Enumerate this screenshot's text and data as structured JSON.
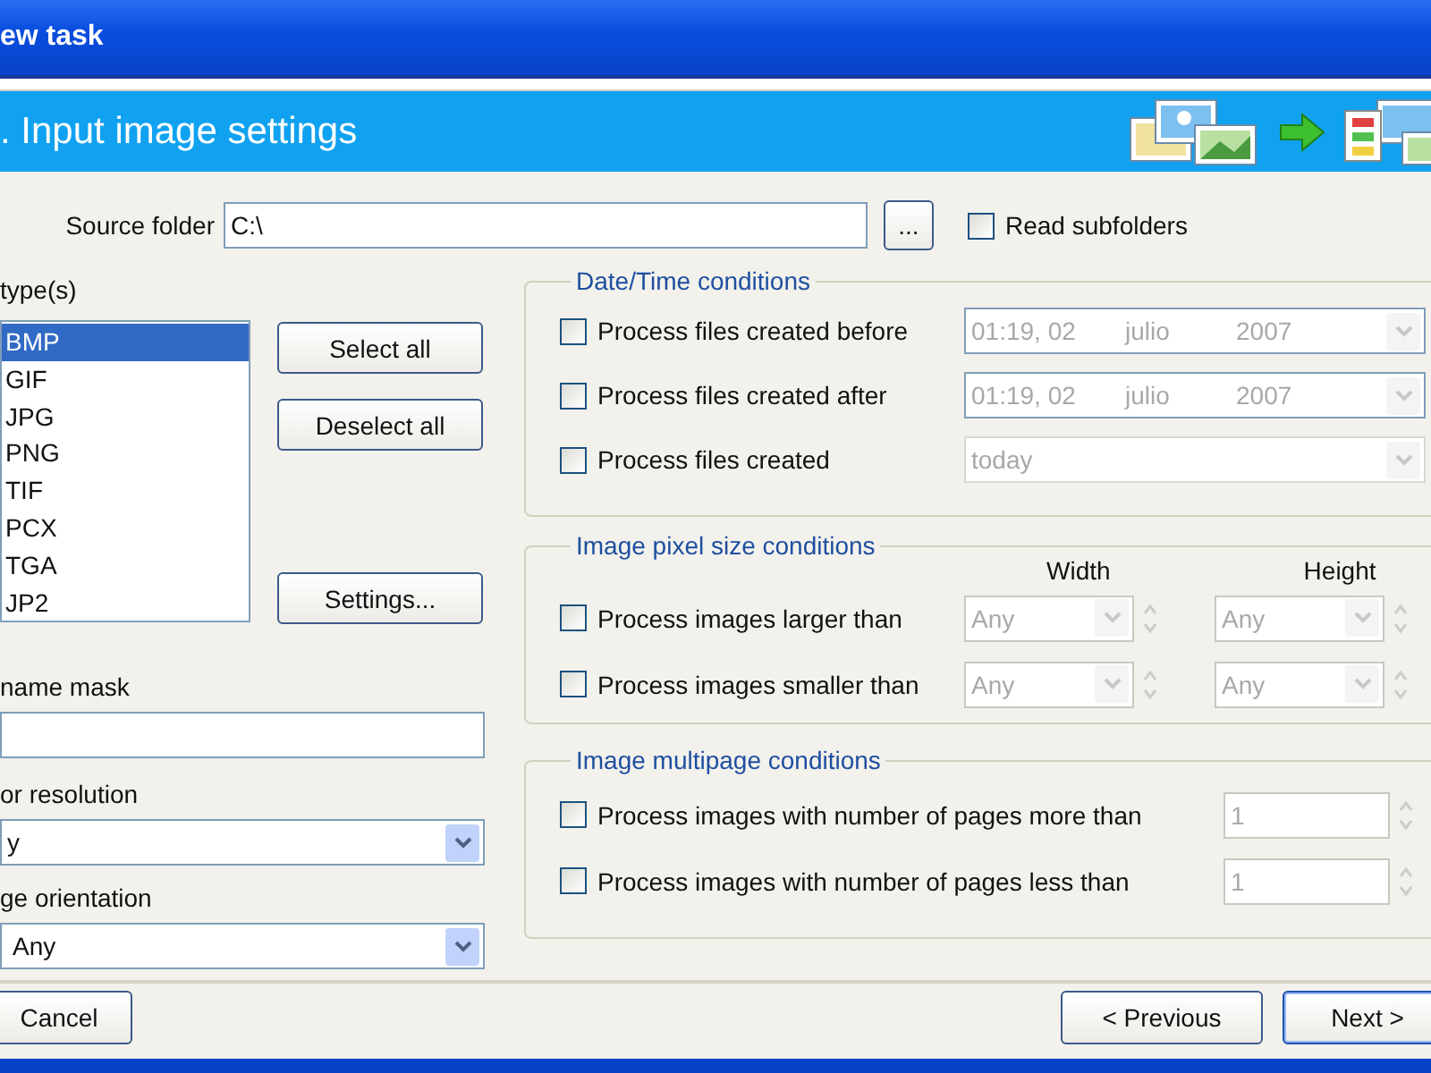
{
  "window": {
    "title": "ew task"
  },
  "header": {
    "title": ". Input image settings"
  },
  "source_folder": {
    "label": "Source folder",
    "value": "C:\\",
    "browse_button": "...",
    "read_subfolders": {
      "label": "Read subfolders",
      "checked": false
    }
  },
  "file_types": {
    "label": "type(s)",
    "items": [
      {
        "label": "BMP",
        "selected": true
      },
      {
        "label": "GIF",
        "selected": false
      },
      {
        "label": "JPG",
        "selected": false
      },
      {
        "label": "PNG",
        "selected": false
      },
      {
        "label": "TIF",
        "selected": false
      },
      {
        "label": "PCX",
        "selected": false
      },
      {
        "label": "TGA",
        "selected": false
      },
      {
        "label": "JP2",
        "selected": false
      }
    ],
    "buttons": [
      "Select all",
      "Deselect all",
      "Settings..."
    ]
  },
  "name_mask": {
    "label": "name mask"
  },
  "color_resolution": {
    "label": "or resolution",
    "value": "y"
  },
  "orientation": {
    "label": "ge orientation",
    "value": "Any"
  },
  "date_time": {
    "title": "Date/Time conditions",
    "rows": [
      {
        "kind": "date",
        "label": "Process files created before",
        "checked": false,
        "time": "01:19, 02",
        "month": "julio",
        "year": "2007"
      },
      {
        "kind": "date",
        "label": "Process files created after",
        "checked": false,
        "time": "01:19, 02",
        "month": "julio",
        "year": "2007"
      },
      {
        "kind": "period",
        "label": "Process files created",
        "checked": false,
        "value": "today"
      }
    ]
  },
  "pixel_size": {
    "title": "Image pixel size conditions",
    "columns": [
      "Width",
      "Height"
    ],
    "rows": [
      {
        "label": "Process images larger than",
        "checked": false,
        "width": "Any",
        "height": "Any"
      },
      {
        "label": "Process images smaller than",
        "checked": false,
        "width": "Any",
        "height": "Any"
      }
    ]
  },
  "multipage": {
    "title": "Image multipage conditions",
    "rows": [
      {
        "label": "Process images with number of pages more than",
        "checked": false,
        "value": "1"
      },
      {
        "label": "Process images with number of pages less than",
        "checked": false,
        "value": "1"
      }
    ]
  },
  "buttons": {
    "cancel": "Cancel",
    "previous": "< Previous",
    "next": "Next >"
  }
}
